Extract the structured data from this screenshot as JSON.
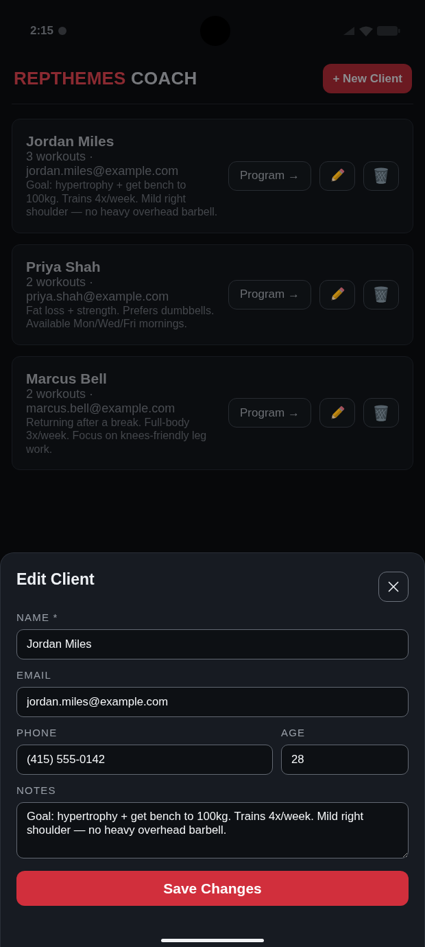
{
  "status_bar": {
    "time": "2:15"
  },
  "header": {
    "title": [
      {
        "text": "REPTHEMES",
        "kind": "accent"
      },
      {
        "text": "COACH",
        "kind": "plain"
      }
    ],
    "new_client_button": "+ New Client"
  },
  "clients": [
    {
      "name": "Jordan Miles",
      "workouts": "3 workouts ·",
      "email": "jordan.miles@example.com",
      "notes": "Goal: hypertrophy + get bench to 100kg. Trains 4x/week. Mild right shoulder — no heavy overhead barbell.",
      "program_button": "Program →"
    },
    {
      "name": "Priya Shah",
      "workouts": "2 workouts ·",
      "email": "priya.shah@example.com",
      "notes": "Fat loss + strength. Prefers dumbbells. Available Mon/Wed/Fri mornings.",
      "program_button": "Program →"
    },
    {
      "name": "Marcus Bell",
      "workouts": "2 workouts ·",
      "email": "marcus.bell@example.com",
      "notes": "Returning after a break. Full-body 3x/week. Focus on knees-friendly leg work.",
      "program_button": "Program →"
    }
  ],
  "edit_sheet": {
    "title": "Edit Client",
    "rows": [
      {
        "fields": [
          {
            "label": "NAME *",
            "value": "Jordan Miles",
            "kind": "input"
          }
        ]
      },
      {
        "fields": [
          {
            "label": "EMAIL",
            "value": "jordan.miles@example.com",
            "kind": "input"
          }
        ]
      },
      {
        "fields": [
          {
            "label": "PHONE",
            "value": "(415) 555-0142",
            "kind": "input"
          },
          {
            "label": "AGE",
            "value": "28",
            "kind": "input"
          }
        ]
      },
      {
        "fields": [
          {
            "label": "NOTES",
            "value": "Goal: hypertrophy + get bench to 100kg. Trains 4x/week. Mild right shoulder — no heavy overhead barbell.",
            "kind": "textarea"
          }
        ]
      }
    ],
    "save_button": "Save Changes"
  }
}
